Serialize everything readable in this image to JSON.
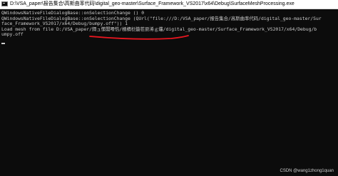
{
  "window": {
    "title": "D:\\VSA_paper\\报告集合\\高斯曲率代码\\digital_geo-master\\Surface_Framework_VS2017\\x64\\Debug\\SurfaceMeshProcessing.exe"
  },
  "console": {
    "lines": [
      "QWindowsNativeFileDialogBase::onSelectionChange () 0",
      "QWindowsNativeFileDialogBase::onSelectionChange (QUrl(\"file:///D:/VSA_paper/报告集合/高斯曲率代码/digital_geo-master/Sur",
      "face_Framework_VS2017/x64/Debug/bumpy.off\")) 1",
      "Load mesh from file D:/VSA_paper/鎶ュ憡闆嗗悎/楂樻柉鏇茬巼浠ｇ爜/digital_geo-master/Surface_Framework_VS2017/x64/Debug/b",
      "umpy.off"
    ]
  },
  "colors": {
    "console_bg": "#0c0c0c",
    "console_fg": "#cccccc",
    "annotation": "#e8161f"
  },
  "watermark": "CSDN @wang1zhong1quan"
}
